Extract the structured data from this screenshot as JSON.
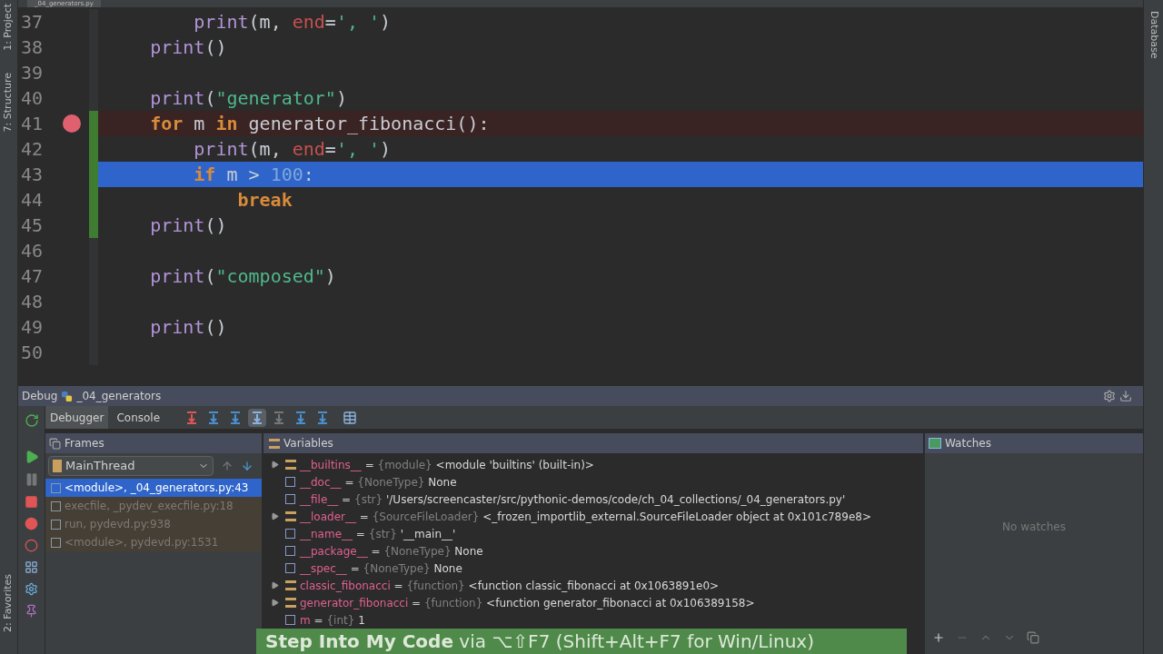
{
  "editor_tab": {
    "title": "_04_generators.py"
  },
  "left_strip": [
    {
      "label": "1: Project"
    },
    {
      "label": "7: Structure"
    }
  ],
  "left_strip_bottom": [
    {
      "label": "2: Favorites"
    }
  ],
  "right_strip": [
    {
      "label": "Database"
    }
  ],
  "code_lines": [
    {
      "number": "37",
      "breakpoint": false,
      "current": false,
      "changed": false,
      "tokens": [
        {
          "kind": "call",
          "text": "        print"
        },
        {
          "kind": "plain",
          "text": "(m, "
        },
        {
          "kind": "param",
          "text": "end"
        },
        {
          "kind": "plain",
          "text": "="
        },
        {
          "kind": "string",
          "text": "', '"
        },
        {
          "kind": "plain",
          "text": ")"
        }
      ]
    },
    {
      "number": "38",
      "breakpoint": false,
      "current": false,
      "changed": false,
      "tokens": [
        {
          "kind": "call",
          "text": "    print"
        },
        {
          "kind": "plain",
          "text": "()"
        }
      ]
    },
    {
      "number": "39",
      "breakpoint": false,
      "current": false,
      "changed": false
    },
    {
      "number": "40",
      "breakpoint": false,
      "current": false,
      "changed": false,
      "tokens": [
        {
          "kind": "call",
          "text": "    print"
        },
        {
          "kind": "plain",
          "text": "("
        },
        {
          "kind": "string",
          "text": "\"generator\""
        },
        {
          "kind": "plain",
          "text": ")"
        }
      ]
    },
    {
      "number": "41",
      "breakpoint": true,
      "current": false,
      "changed": true,
      "tokens": [
        {
          "kind": "keyword",
          "text": "    for"
        },
        {
          "kind": "plain",
          "text": " m "
        },
        {
          "kind": "keyword",
          "text": "in"
        },
        {
          "kind": "plain",
          "text": " generator_fibonacci():"
        }
      ]
    },
    {
      "number": "42",
      "breakpoint": false,
      "current": false,
      "changed": true,
      "tokens": [
        {
          "kind": "call",
          "text": "        print"
        },
        {
          "kind": "plain",
          "text": "(m, "
        },
        {
          "kind": "param",
          "text": "end"
        },
        {
          "kind": "plain",
          "text": "="
        },
        {
          "kind": "string",
          "text": "', '"
        },
        {
          "kind": "plain",
          "text": ")"
        }
      ]
    },
    {
      "number": "43",
      "breakpoint": false,
      "current": true,
      "changed": true,
      "tokens": [
        {
          "kind": "keyword",
          "text": "        if"
        },
        {
          "kind": "plain",
          "text": " m > "
        },
        {
          "kind": "number",
          "text": "100"
        },
        {
          "kind": "plain",
          "text": ":"
        }
      ]
    },
    {
      "number": "44",
      "breakpoint": false,
      "current": false,
      "changed": true,
      "tokens": [
        {
          "kind": "keyword",
          "text": "            break"
        }
      ]
    },
    {
      "number": "45",
      "breakpoint": false,
      "current": false,
      "changed": true,
      "tokens": [
        {
          "kind": "call",
          "text": "    print"
        },
        {
          "kind": "plain",
          "text": "()"
        }
      ]
    },
    {
      "number": "46",
      "breakpoint": false,
      "current": false,
      "changed": false
    },
    {
      "number": "47",
      "breakpoint": false,
      "current": false,
      "changed": false,
      "tokens": [
        {
          "kind": "call",
          "text": "    print"
        },
        {
          "kind": "plain",
          "text": "("
        },
        {
          "kind": "string",
          "text": "\"composed\""
        },
        {
          "kind": "plain",
          "text": ")"
        }
      ]
    },
    {
      "number": "48",
      "breakpoint": false,
      "current": false,
      "changed": false
    },
    {
      "number": "49",
      "breakpoint": false,
      "current": false,
      "changed": false,
      "tokens": [
        {
          "kind": "call",
          "text": "    print"
        },
        {
          "kind": "plain",
          "text": "()"
        }
      ]
    },
    {
      "number": "50",
      "breakpoint": false,
      "current": false,
      "changed": false
    }
  ],
  "debug": {
    "label": "Debug",
    "config": "_04_generators",
    "tabs": [
      {
        "label": "Debugger",
        "selected": true
      },
      {
        "label": "Console",
        "selected": false
      }
    ],
    "frames": {
      "title": "Frames",
      "thread": "MainThread",
      "items": [
        {
          "label": "<module>, _04_generators.py:43",
          "selected": true
        },
        {
          "label": "execfile, _pydev_execfile.py:18",
          "selected": false
        },
        {
          "label": "run, pydevd.py:938",
          "selected": false
        },
        {
          "label": "<module>, pydevd.py:1531",
          "selected": false
        }
      ]
    },
    "variables": {
      "title": "Variables",
      "items": [
        {
          "kind": "object",
          "name": "__builtins__",
          "sep": "=",
          "type": "{module}",
          "value": "<module 'builtins' (built-in)>"
        },
        {
          "kind": "simple",
          "name": "__doc__",
          "sep": "=",
          "type": "{NoneType}",
          "value": "None"
        },
        {
          "kind": "simple",
          "name": "__file__",
          "sep": "=",
          "type": "{str}",
          "value": "'/Users/screencaster/src/pythonic-demos/code/ch_04_collections/_04_generators.py'"
        },
        {
          "kind": "object",
          "name": "__loader__",
          "sep": "=",
          "type": "{SourceFileLoader}",
          "value": "<_frozen_importlib_external.SourceFileLoader object at 0x101c789e8>"
        },
        {
          "kind": "simple",
          "name": "__name__",
          "sep": "=",
          "type": "{str}",
          "value": "'__main__'"
        },
        {
          "kind": "simple",
          "name": "__package__",
          "sep": "=",
          "type": "{NoneType}",
          "value": "None"
        },
        {
          "kind": "simple",
          "name": "__spec__",
          "sep": "=",
          "type": "{NoneType}",
          "value": "None"
        },
        {
          "kind": "object",
          "name": "classic_fibonacci",
          "sep": "=",
          "type": "{function}",
          "value": "<function classic_fibonacci at 0x1063891e0>"
        },
        {
          "kind": "object",
          "name": "generator_fibonacci",
          "sep": "=",
          "type": "{function}",
          "value": "<function generator_fibonacci at 0x106389158>"
        },
        {
          "kind": "simple",
          "name": "m",
          "sep": "=",
          "type": "{int}",
          "value": "1"
        }
      ]
    },
    "watches": {
      "title": "Watches",
      "empty": "No watches"
    }
  },
  "tip": {
    "bold": "Step Into My Code",
    "rest": "via ⌥⇧F7 (Shift+Alt+F7 for Win/Linux)"
  }
}
